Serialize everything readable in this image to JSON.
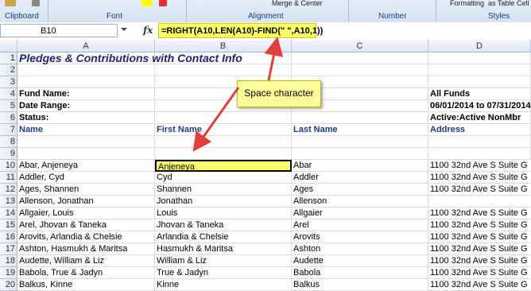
{
  "ribbon": {
    "groups": [
      "Clipboard",
      "Font",
      "Alignment",
      "Number",
      "Styles"
    ],
    "merge_label": "Merge & Center",
    "format_label": "Formatting",
    "table_label": "as Table",
    "cell_label": "Cell"
  },
  "formula_bar": {
    "name_box": "B10",
    "fx": "fx",
    "formula": "=RIGHT(A10,LEN(A10)-FIND(\" \",A10,1))"
  },
  "columns": [
    "A",
    "B",
    "C",
    "D"
  ],
  "rows": [
    "1",
    "2",
    "3",
    "4",
    "5",
    "6",
    "7",
    "8",
    "9",
    "10",
    "11",
    "12",
    "13",
    "14",
    "15",
    "16",
    "17",
    "18",
    "19",
    "20"
  ],
  "sheet": {
    "title": "Pledges & Contributions with Contact Info",
    "fund_name_label": "Fund Name:",
    "date_range_label": "Date Range:",
    "status_label": "Status:",
    "fund_name_value": "All Funds",
    "date_range_value": "06/01/2014 to 07/31/2014",
    "status_value": "Active:Active NonMbr",
    "headers": {
      "name": "Name",
      "first_name": "First Name",
      "last_name": "Last Name",
      "address": "Address"
    },
    "data_rows": [
      {
        "name": "Abar, Anjeneya",
        "first": "Anjeneya",
        "last": "Abar",
        "address": "1100 32nd Ave S Suite G"
      },
      {
        "name": "Addler, Cyd",
        "first": "Cyd",
        "last": "Addler",
        "address": "1100 32nd Ave S Suite G"
      },
      {
        "name": "Ages, Shannen",
        "first": "Shannen",
        "last": "Ages",
        "address": "1100 32nd Ave S Suite G"
      },
      {
        "name": "Allenson, Jonathan",
        "first": "Jonathan",
        "last": "Allenson",
        "address": ""
      },
      {
        "name": "Allgaier, Louis",
        "first": "Louis",
        "last": "Allgaier",
        "address": "1100 32nd Ave S Suite G"
      },
      {
        "name": "Arel, Jhovan & Taneka",
        "first": "Jhovan & Taneka",
        "last": "Arel",
        "address": "1100 32nd Ave S Suite G"
      },
      {
        "name": "Arovits, Arlandia & Chelsie",
        "first": "Arlandia & Chelsie",
        "last": "Arovits",
        "address": "1100 32nd Ave S Suite G"
      },
      {
        "name": "Ashton, Hasmukh & Maritsa",
        "first": "Hasmukh & Maritsa",
        "last": "Ashton",
        "address": "1100 32nd Ave S Suite G"
      },
      {
        "name": "Audette, William & Liz",
        "first": "William & Liz",
        "last": "Audette",
        "address": "1100 32nd Ave S Suite G"
      },
      {
        "name": "Babola, True & Jadyn",
        "first": "True & Jadyn",
        "last": "Babola",
        "address": "1100 32nd Ave S Suite G"
      },
      {
        "name": "Balkus, Kinne",
        "first": "Kinne",
        "last": "Balkus",
        "address": "1100 32nd Ave S Suite G"
      }
    ]
  },
  "callout": {
    "text": "Space character"
  },
  "colors": {
    "highlight": "#ffff66",
    "header_blue": "#1f3a8a",
    "arrow_red": "#e0403a"
  }
}
